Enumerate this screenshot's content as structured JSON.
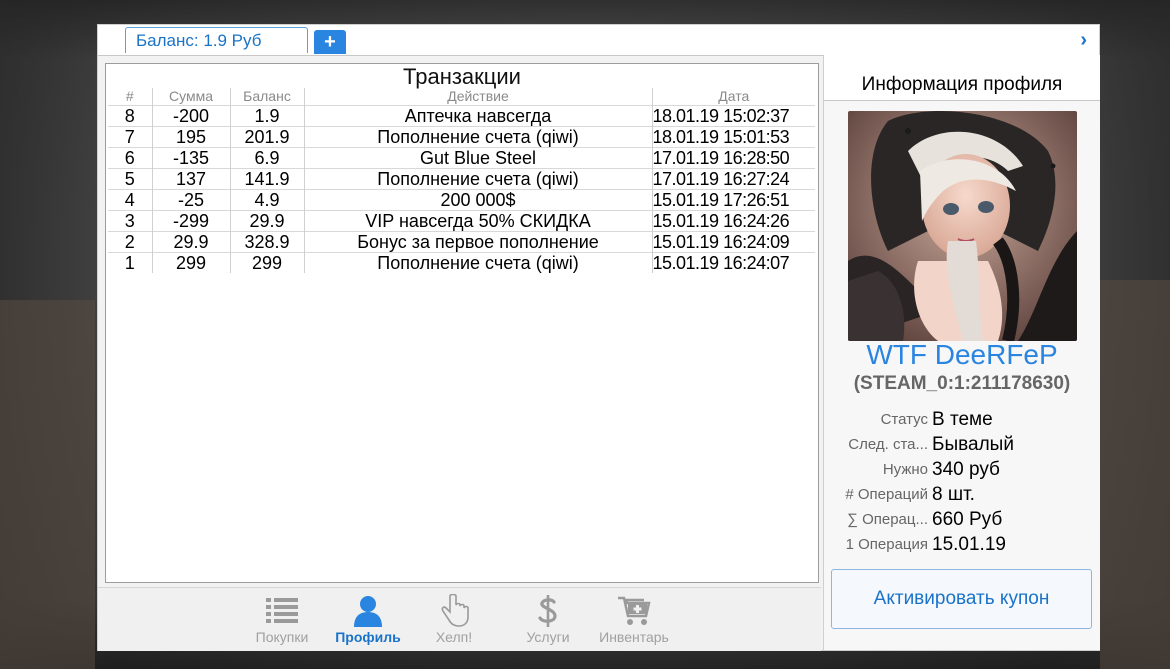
{
  "tabs": {
    "balance_label": "Баланс: 1.9 Руб",
    "add_label": "+"
  },
  "window": {
    "close_label": "›"
  },
  "transactions": {
    "title": "Транзакции",
    "columns": [
      "#",
      "Сумма",
      "Баланс",
      "Действие",
      "Дата"
    ],
    "rows": [
      {
        "n": "8",
        "amount": "-200",
        "balance": "1.9",
        "action": "Аптечка навсегда",
        "date": "18.01.19 15:02:37"
      },
      {
        "n": "7",
        "amount": "195",
        "balance": "201.9",
        "action": "Пополнение счета (qiwi)",
        "date": "18.01.19 15:01:53"
      },
      {
        "n": "6",
        "amount": "-135",
        "balance": "6.9",
        "action": "Gut Blue Steel",
        "date": "17.01.19 16:28:50"
      },
      {
        "n": "5",
        "amount": "137",
        "balance": "141.9",
        "action": "Пополнение счета (qiwi)",
        "date": "17.01.19 16:27:24"
      },
      {
        "n": "4",
        "amount": "-25",
        "balance": "4.9",
        "action": "200 000$",
        "date": "15.01.19 17:26:51"
      },
      {
        "n": "3",
        "amount": "-299",
        "balance": "29.9",
        "action": "VIP навсегда 50% СКИДКА",
        "date": "15.01.19 16:24:26"
      },
      {
        "n": "2",
        "amount": "29.9",
        "balance": "328.9",
        "action": "Бонус за первое пополнение",
        "date": "15.01.19 16:24:09"
      },
      {
        "n": "1",
        "amount": "299",
        "balance": "299",
        "action": "Пополнение счета (qiwi)",
        "date": "15.01.19 16:24:07"
      }
    ]
  },
  "nav": [
    {
      "label": "Покупки",
      "icon": "list-icon",
      "active": false
    },
    {
      "label": "Профиль",
      "icon": "user-icon",
      "active": true
    },
    {
      "label": "Хелп!",
      "icon": "hand-pointer-icon",
      "active": false
    },
    {
      "label": "Услуги",
      "icon": "dollar-icon",
      "active": false
    },
    {
      "label": "Инвентарь",
      "icon": "cart-plus-icon",
      "active": false
    }
  ],
  "profile": {
    "title": "Информация профиля",
    "username": "WTF DeeRFeP",
    "steam_id": "(STEAM_0:1:211178630)",
    "stats": [
      {
        "label": "Статус",
        "value": "В теме"
      },
      {
        "label": "След. ста...",
        "value": "Бывалый"
      },
      {
        "label": "Нужно",
        "value": "340 руб"
      },
      {
        "label": "# Операций",
        "value": "8 шт."
      },
      {
        "label": "∑ Операц...",
        "value": "660 Руб"
      },
      {
        "label": "1 Операция",
        "value": "15.01.19"
      }
    ],
    "coupon_button": "Активировать купон"
  },
  "colors": {
    "accent": "#2a85e0",
    "accent_text": "#1a73c8",
    "inactive_nav": "#a0a0a0"
  }
}
